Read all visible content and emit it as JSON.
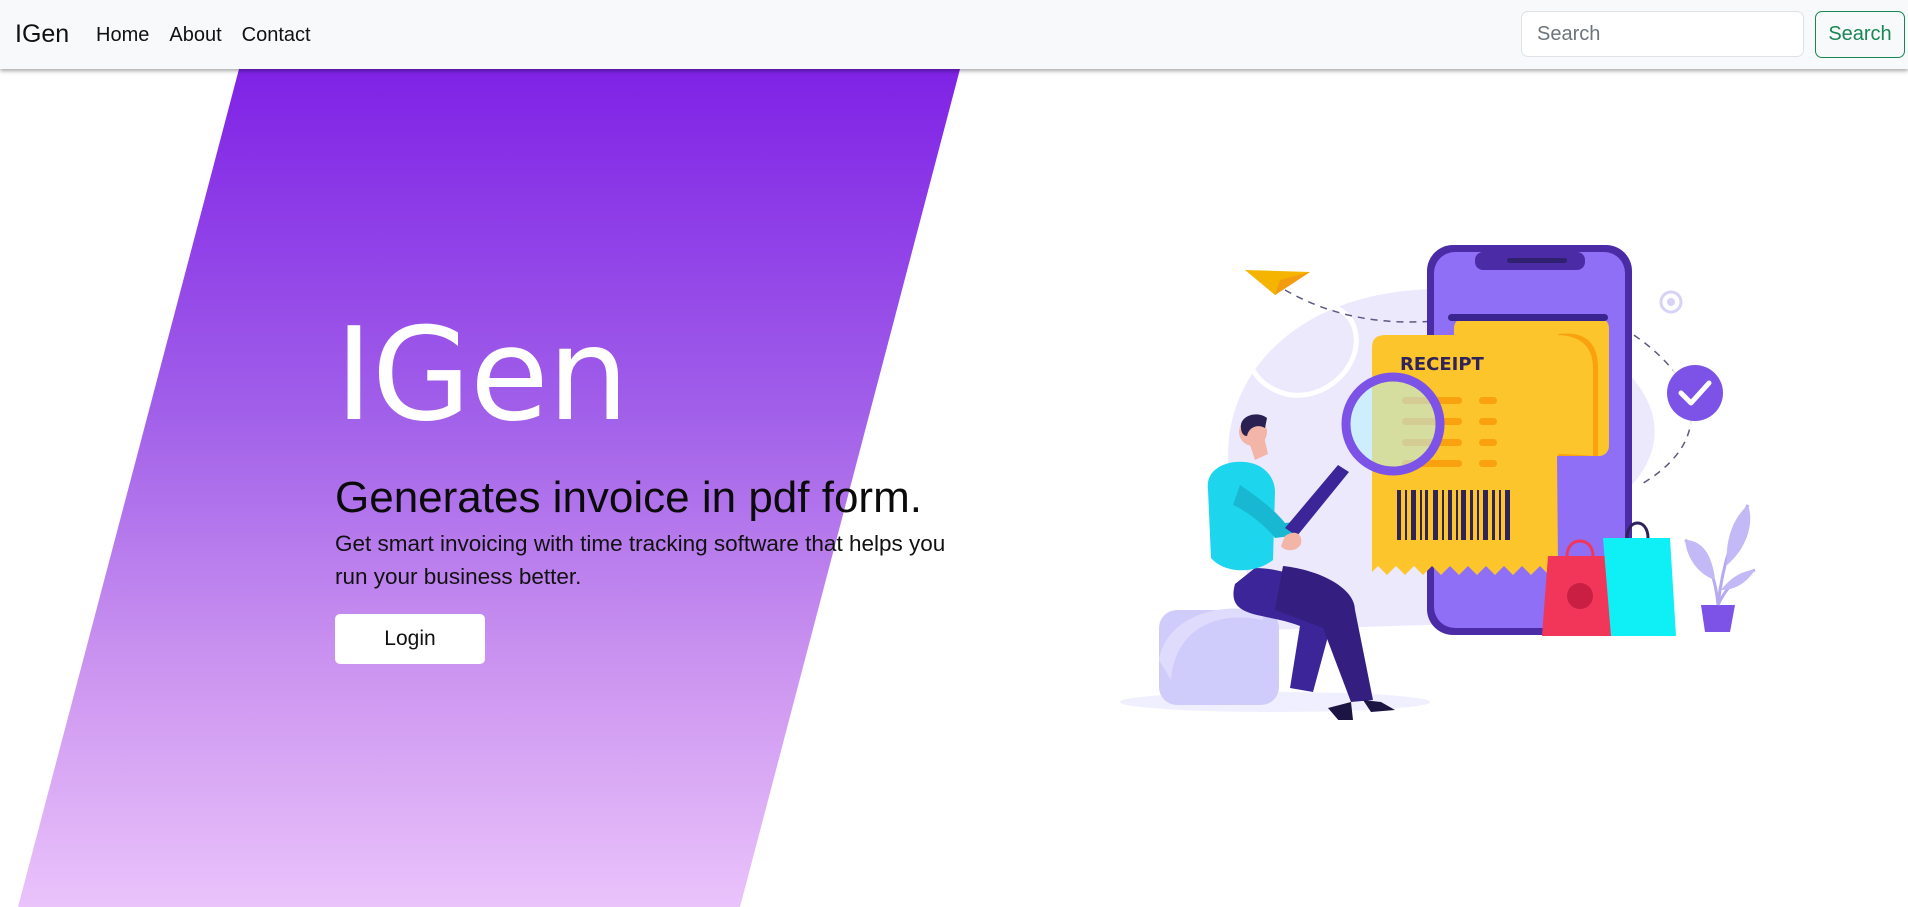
{
  "navbar": {
    "brand": "IGen",
    "links": [
      "Home",
      "About",
      "Contact"
    ],
    "search_placeholder": "Search",
    "search_button": "Search"
  },
  "hero": {
    "title": "IGen",
    "subtitle": "Generates invoice in pdf form.",
    "text": "Get smart invoicing with time tracking software that helps you run your business better.",
    "login_label": "Login"
  },
  "illustration": {
    "receipt_label": "RECEIPT"
  },
  "colors": {
    "hero_gradient_top": "#7f22e6",
    "hero_gradient_bottom": "#eac3fb",
    "search_accent": "#198754",
    "phone": "#8f6ff5",
    "receipt": "#fbc52b"
  }
}
